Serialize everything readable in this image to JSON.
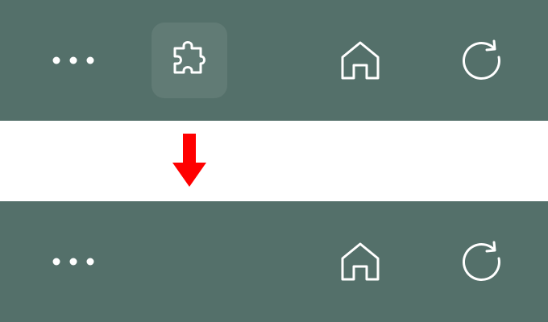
{
  "colors": {
    "toolbar_background": "#54706a",
    "icon_stroke": "#ffffff",
    "arrow": "#ff0000",
    "band": "#ffffff"
  },
  "toolbar_before": {
    "buttons": [
      {
        "icon": "more-horizontal-icon",
        "highlighted": false
      },
      {
        "icon": "extensions-puzzle-icon",
        "highlighted": true
      },
      {
        "icon": "home-icon",
        "highlighted": false
      },
      {
        "icon": "refresh-icon",
        "highlighted": false
      }
    ]
  },
  "transition_arrow": {
    "icon": "arrow-down-icon"
  },
  "toolbar_after": {
    "buttons": [
      {
        "icon": "more-horizontal-icon",
        "highlighted": false
      },
      {
        "icon": "home-icon",
        "highlighted": false
      },
      {
        "icon": "refresh-icon",
        "highlighted": false
      }
    ]
  }
}
